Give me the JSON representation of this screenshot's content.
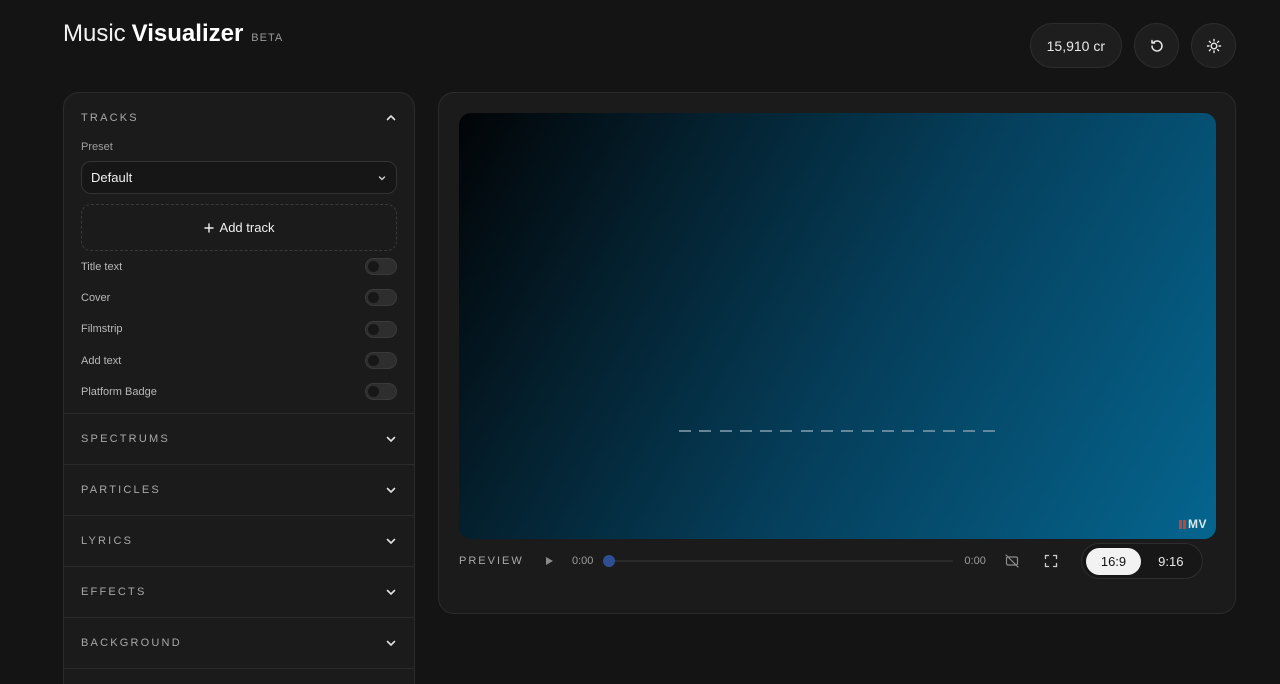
{
  "header": {
    "title_prefix": "Music",
    "title_main": "Visualizer",
    "badge": "BETA",
    "credits": "15,910 cr",
    "reset_icon": "refresh-icon",
    "theme_icon": "sun-icon"
  },
  "sidebar": {
    "tracks": {
      "title": "TRACKS",
      "preset_label": "Preset",
      "preset_value": "Default",
      "add_track_label": "Add track",
      "toggles": [
        {
          "label": "Title text",
          "on": false
        },
        {
          "label": "Cover",
          "on": false
        },
        {
          "label": "Filmstrip",
          "on": false
        },
        {
          "label": "Add text",
          "on": false
        },
        {
          "label": "Platform Badge",
          "on": false
        }
      ]
    },
    "sections": [
      "SPECTRUMS",
      "PARTICLES",
      "LYRICS",
      "EFFECTS",
      "BACKGROUND"
    ]
  },
  "preview": {
    "label": "PREVIEW",
    "time_current": "0:00",
    "time_total": "0:00",
    "progress": 0,
    "watermark": "MV",
    "ratios": [
      {
        "label": "16:9",
        "active": true
      },
      {
        "label": "9:16",
        "active": false
      }
    ]
  },
  "colors": {
    "background": "#141414",
    "panel": "#1b1b1b",
    "canvas_gradient_start": "#020406",
    "canvas_gradient_end": "#05658f",
    "scrub_thumb": "#2f4f94",
    "logo_bars": "#c6452f"
  }
}
